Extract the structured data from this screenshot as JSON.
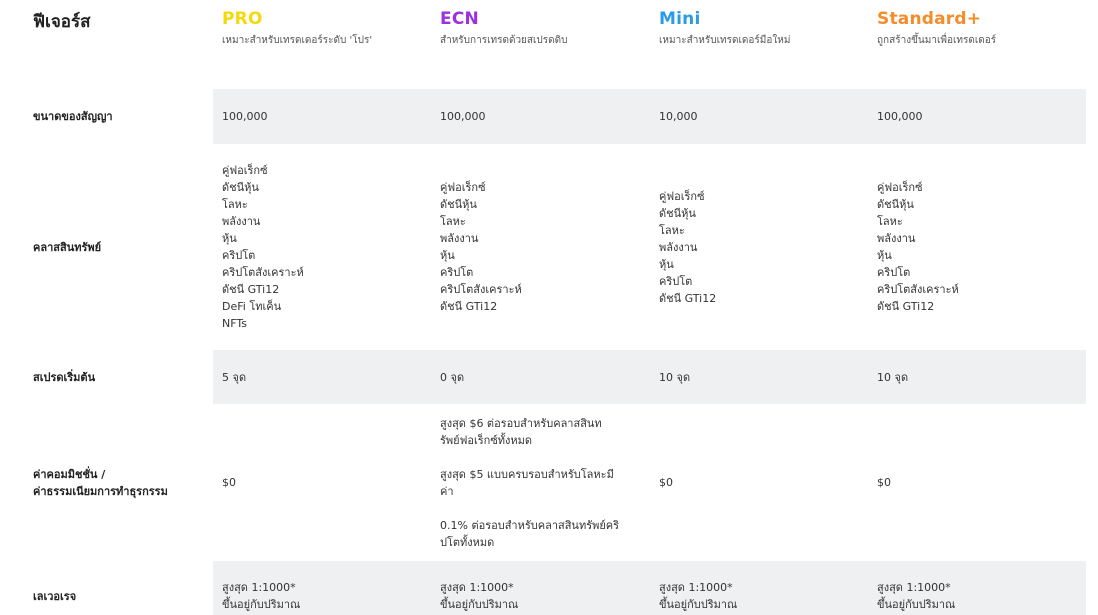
{
  "colors": {
    "pro": "#f5d90a",
    "ecn": "#9b30e0",
    "mini": "#2b9be8",
    "standard": "#f58c2a",
    "row_shade": "#eef0f2"
  },
  "header": {
    "title": "ฟีเจอร์ส",
    "plans": [
      {
        "name": "PRO",
        "desc": "เหมาะสำหรับเทรดเดอร์ระดับ 'โปร'"
      },
      {
        "name": "ECN",
        "desc": "สำหรับการเทรดด้วยสเปรดดิบ"
      },
      {
        "name": "Mini",
        "desc": "เหมาะสำหรับเทรดเดอร์มือใหม่"
      },
      {
        "name": "Standard+",
        "desc": "ถูกสร้างขึ้นมาเพื่อเทรดเดอร์"
      }
    ]
  },
  "rows": {
    "contract": {
      "label": "ขนาดของสัญญา",
      "values": [
        "100,000",
        "100,000",
        "10,000",
        "100,000"
      ]
    },
    "assets": {
      "label": "คลาสสินทรัพย์",
      "pro": [
        "คู่ฟอเร็กซ์",
        "ดัชนีหุ้น",
        "โลหะ",
        "พลังงาน",
        "หุ้น",
        "คริปโต",
        "คริปโตสังเคราะห์",
        "ดัชนี GTi12",
        "DeFi โทเค็น",
        "NFTs"
      ],
      "ecn": [
        "คู่ฟอเร็กซ์",
        "ดัชนีหุ้น",
        "โลหะ",
        "พลังงาน",
        "หุ้น",
        "คริปโต",
        "คริปโตสังเคราะห์",
        "ดัชนี GTi12"
      ],
      "mini": [
        "คู่ฟอเร็กซ์",
        "ดัชนีหุ้น",
        "โลหะ",
        "พลังงาน",
        "หุ้น",
        "คริปโต",
        "ดัชนี GTi12"
      ],
      "standard": [
        "คู่ฟอเร็กซ์",
        "ดัชนีหุ้น",
        "โลหะ",
        "พลังงาน",
        "หุ้น",
        "คริปโต",
        "คริปโตสังเคราะห์",
        "ดัชนี GTi12"
      ]
    },
    "spread": {
      "label": "สเปรดเริ่มต้น",
      "values": [
        "5 จุด",
        "0 จุด",
        "10 จุด",
        "10 จุด"
      ]
    },
    "commission": {
      "label_line1": "ค่าคอมมิชชั่น /",
      "label_line2": "ค่าธรรมเนียมการทำธุรกรรม",
      "pro": "$0",
      "ecn": [
        "สูงสุด $6 ต่อรอบสำหรับคลาสสินทรัพย์ฟอเร็กซ์ทั้งหมด",
        "สูงสุด $5 แบบครบรอบสำหรับโลหะมีค่า",
        "0.1% ต่อรอบสำหรับคลาสสินทรัพย์คริปโตทั้งหมด"
      ],
      "mini": "$0",
      "standard": "$0"
    },
    "leverage": {
      "label": "เลเวอเรจ",
      "line1": "สูงสุด 1:1000*",
      "line2": "ขึ้นอยู่กับปริมาณ"
    }
  }
}
